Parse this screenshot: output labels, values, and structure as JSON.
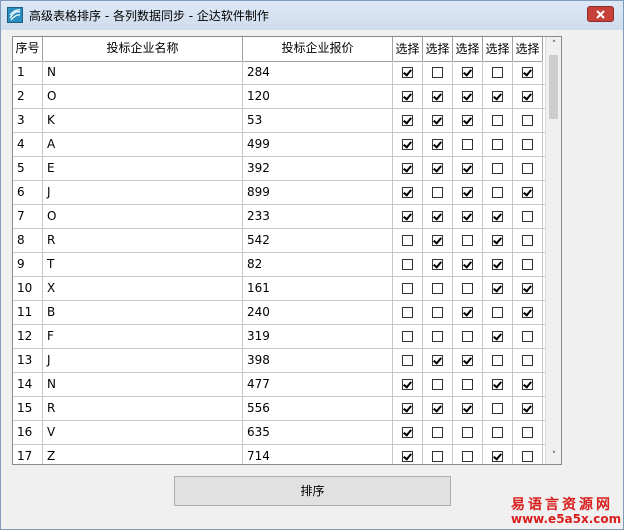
{
  "window": {
    "title": "高级表格排序  -  各列数据同步 - 企达软件制作",
    "close_icon": "close-icon",
    "app_icon": "app-icon"
  },
  "table": {
    "headers": [
      "序号",
      "投标企业名称",
      "投标企业报价",
      "选择",
      "选择",
      "选择",
      "选择",
      "选择"
    ],
    "rows": [
      {
        "index": "1",
        "name": "N",
        "price": "284",
        "checks": [
          true,
          false,
          true,
          false,
          true
        ]
      },
      {
        "index": "2",
        "name": "O",
        "price": "120",
        "checks": [
          true,
          true,
          true,
          true,
          true
        ]
      },
      {
        "index": "3",
        "name": "K",
        "price": "53",
        "checks": [
          true,
          true,
          true,
          false,
          false
        ]
      },
      {
        "index": "4",
        "name": "A",
        "price": "499",
        "checks": [
          true,
          true,
          false,
          false,
          false
        ]
      },
      {
        "index": "5",
        "name": "E",
        "price": "392",
        "checks": [
          true,
          true,
          true,
          false,
          false
        ]
      },
      {
        "index": "6",
        "name": "J",
        "price": "899",
        "checks": [
          true,
          false,
          true,
          false,
          true
        ]
      },
      {
        "index": "7",
        "name": "O",
        "price": "233",
        "checks": [
          true,
          true,
          true,
          true,
          false
        ]
      },
      {
        "index": "8",
        "name": "R",
        "price": "542",
        "checks": [
          false,
          true,
          false,
          true,
          false
        ]
      },
      {
        "index": "9",
        "name": "T",
        "price": "82",
        "checks": [
          false,
          true,
          true,
          true,
          false
        ]
      },
      {
        "index": "10",
        "name": "X",
        "price": "161",
        "checks": [
          false,
          false,
          false,
          true,
          true
        ]
      },
      {
        "index": "11",
        "name": "B",
        "price": "240",
        "checks": [
          false,
          false,
          true,
          false,
          true
        ]
      },
      {
        "index": "12",
        "name": "F",
        "price": "319",
        "checks": [
          false,
          false,
          false,
          true,
          false
        ]
      },
      {
        "index": "13",
        "name": "J",
        "price": "398",
        "checks": [
          false,
          true,
          true,
          false,
          false
        ]
      },
      {
        "index": "14",
        "name": "N",
        "price": "477",
        "checks": [
          true,
          false,
          false,
          true,
          true
        ]
      },
      {
        "index": "15",
        "name": "R",
        "price": "556",
        "checks": [
          true,
          true,
          true,
          false,
          true
        ]
      },
      {
        "index": "16",
        "name": "V",
        "price": "635",
        "checks": [
          true,
          false,
          false,
          false,
          false
        ]
      },
      {
        "index": "17",
        "name": "Z",
        "price": "714",
        "checks": [
          true,
          false,
          false,
          true,
          false
        ]
      }
    ]
  },
  "scrollbar": {
    "up_glyph": "˄",
    "down_glyph": "˅"
  },
  "sort_button": {
    "label": "排序"
  },
  "watermark": {
    "line1": "易语言资源网",
    "line2": "www.e5a5x.com"
  },
  "colors": {
    "close_button": "#c7413a",
    "watermark": "#d91e1e"
  }
}
